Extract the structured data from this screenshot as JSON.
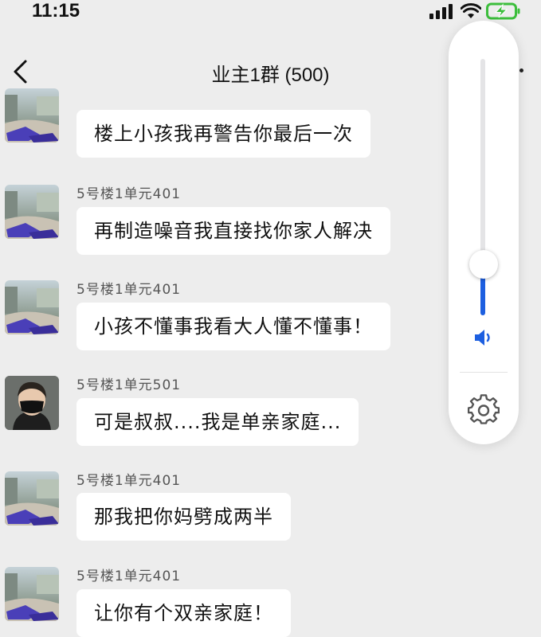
{
  "status_bar": {
    "time": "11:15",
    "battery_color": "#3cbe3c"
  },
  "header": {
    "title": "业主1群 (500)",
    "back_icon": "chevron-left-icon",
    "more_icon": "more-icon"
  },
  "messages": [
    {
      "sender": "",
      "text": "楼上小孩我再警告你最后一次",
      "avatar": "landscape-avatar"
    },
    {
      "sender": "5号楼1单元401",
      "text": "再制造噪音我直接找你家人解决",
      "avatar": "landscape-avatar"
    },
    {
      "sender": "5号楼1单元401",
      "text": "小孩不懂事我看大人懂不懂事！",
      "avatar": "landscape-avatar"
    },
    {
      "sender": "5号楼1单元501",
      "text": "可是叔叔....我是单亲家庭...",
      "avatar": "person-mask-avatar"
    },
    {
      "sender": "5号楼1单元401",
      "text": "那我把你妈劈成两半",
      "avatar": "landscape-avatar"
    },
    {
      "sender": "5号楼1单元401",
      "text": "让你有个双亲家庭！",
      "avatar": "landscape-avatar"
    }
  ],
  "volume_panel": {
    "level": 0.2,
    "accent_color": "#1d5fe0",
    "speaker_icon": "speaker-icon",
    "settings_icon": "gear-icon"
  }
}
